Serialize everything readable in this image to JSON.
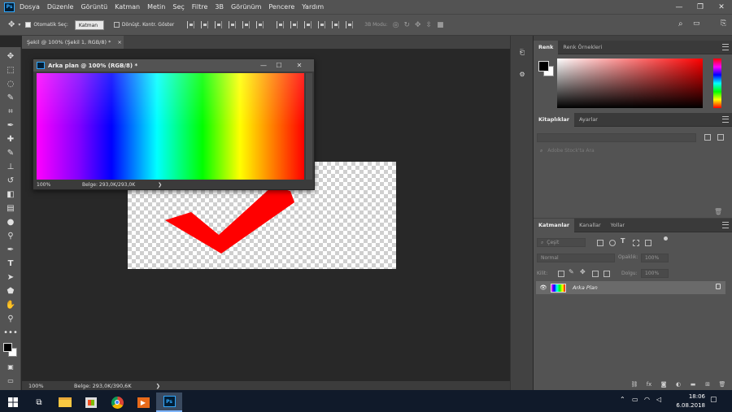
{
  "menubar": {
    "logo": "Ps",
    "items": [
      "Dosya",
      "Düzenle",
      "Görüntü",
      "Katman",
      "Metin",
      "Seç",
      "Filtre",
      "3B",
      "Görünüm",
      "Pencere",
      "Yardım"
    ]
  },
  "options_bar": {
    "auto_select_label": "Otomatik Seç:",
    "auto_select_value": "Katman",
    "transform_label": "Dönüşt. Kontr. Göster",
    "mode_label": "3B Modu:"
  },
  "document_tab": {
    "label": "Şekil @ 100% (Şekil 1, RGB/8) *",
    "close": "×"
  },
  "status_bar": {
    "zoom": "100%",
    "doc_info": "Belge: 293,0K/390,6K",
    "arrow": "❯"
  },
  "floating_window": {
    "title": "Arka plan @ 100% (RGB/8) *",
    "zoom": "100%",
    "doc_info": "Belge: 293,0K/293,0K",
    "arrow": "❯"
  },
  "color_panel": {
    "tabs": [
      "Renk",
      "Renk Örnekleri"
    ]
  },
  "libraries_panel": {
    "tabs": [
      "Kitaplıklar",
      "Ayarlar"
    ],
    "search_placeholder": "Adobe Stock'ta Ara"
  },
  "layers_panel": {
    "tabs": [
      "Katmanlar",
      "Kanallar",
      "Yollar"
    ],
    "filter_label": "Çeşit",
    "blend_mode": "Normal",
    "opacity_label": "Opaklık:",
    "opacity_value": "100%",
    "lock_label": "Kilit:",
    "fill_label": "Dolgu:",
    "fill_value": "100%",
    "layers": [
      {
        "name": "Arka Plan",
        "visible": true,
        "locked": true
      }
    ],
    "footer_icons": [
      "link-icon",
      "fx-icon",
      "mask-icon",
      "adjustment-icon",
      "folder-icon",
      "new-layer-icon",
      "trash-icon"
    ]
  },
  "taskbar": {
    "time": "18:06",
    "date": "6.08.2018"
  },
  "colors": {
    "accent": "#31a8ff",
    "panel": "#535353",
    "canvas": "#282828",
    "checkmark": "#ff0000"
  }
}
